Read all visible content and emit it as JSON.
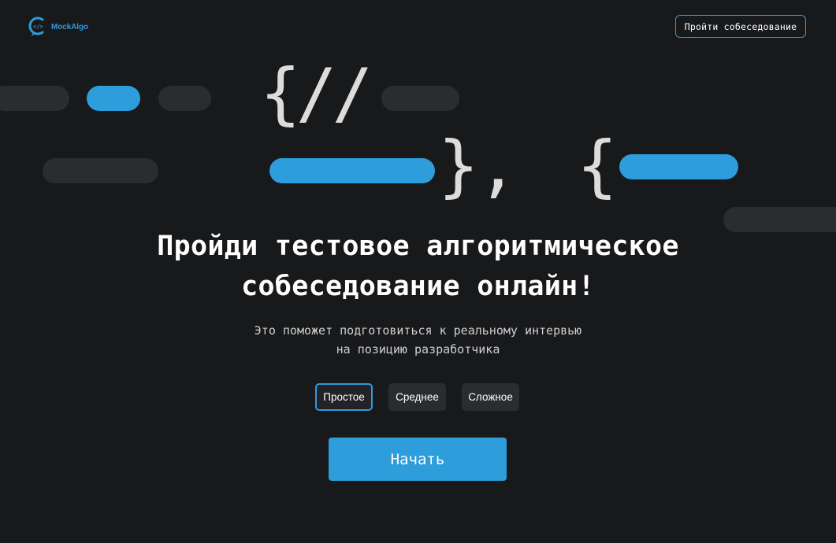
{
  "header": {
    "logo_text": "MockAlgo",
    "logo_code": "</>",
    "cta_label": "Пройти собеседование"
  },
  "decor": {
    "line1_glyphs": "{//",
    "line2_glyphs": "},",
    "line2_open": "{"
  },
  "hero": {
    "title_line1": "Пройди тестовое алгоритмическое",
    "title_line2": "собеседование онлайн!",
    "subtitle_line1": "Это поможет подготовиться к реальному интервью",
    "subtitle_line2": "на позицию разработчика"
  },
  "levels": [
    {
      "label": "Простое",
      "selected": true
    },
    {
      "label": "Среднее",
      "selected": false
    },
    {
      "label": "Сложное",
      "selected": false
    }
  ],
  "start_label": "Начать",
  "colors": {
    "background": "#18191b",
    "accent": "#2e9ddb",
    "pill_gray": "#2b2c2f"
  }
}
